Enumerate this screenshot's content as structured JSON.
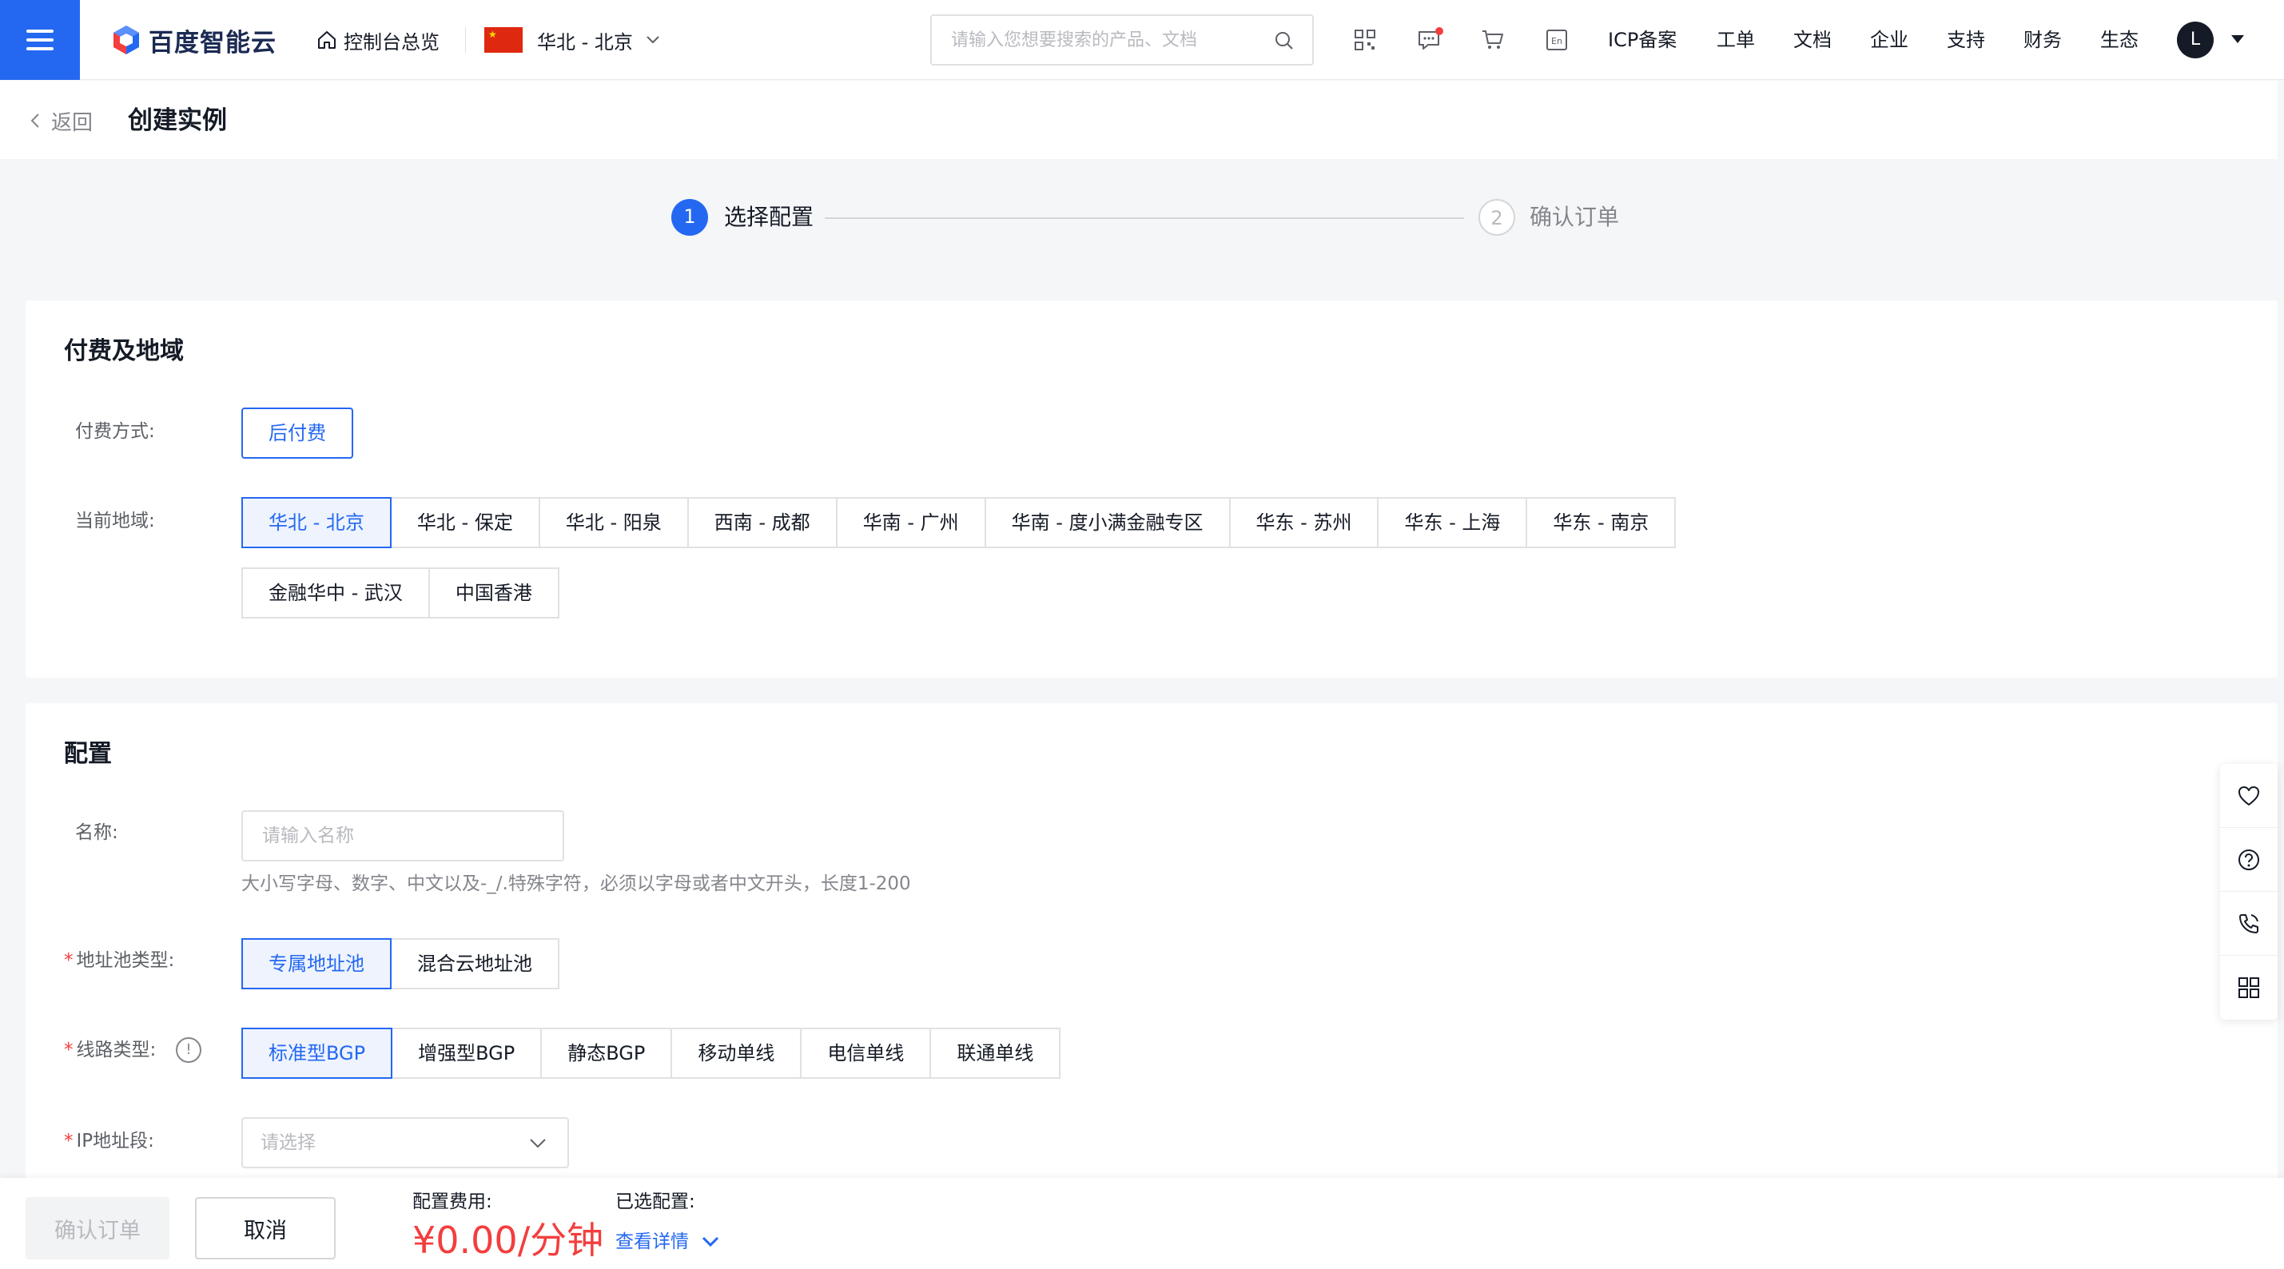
{
  "brand": {
    "logo_text": "百度智能云",
    "primary": "#2468f2",
    "danger": "#f33e3e"
  },
  "topnav": {
    "home_label": "控制台总览",
    "region_label": "华北 - 北京",
    "search_placeholder": "请输入您想要搜索的产品、文档",
    "icons": [
      "qrcode-icon",
      "message-icon",
      "cart-icon",
      "language-en-icon"
    ],
    "lang_icon_text": "En",
    "links": [
      "ICP备案",
      "工单",
      "文档",
      "企业",
      "支持",
      "财务",
      "生态"
    ],
    "avatar_letter": "L"
  },
  "subheader": {
    "back_label": "返回",
    "title": "创建实例"
  },
  "steps": [
    {
      "index": "1",
      "label": "选择配置",
      "active": true
    },
    {
      "index": "2",
      "label": "确认订单",
      "active": false
    }
  ],
  "billing": {
    "title": "付费及地域",
    "payment_label": "付费方式:",
    "payment_options": [
      "后付费"
    ],
    "region_label": "当前地域:",
    "regions_row1": [
      "华北 - 北京",
      "华北 - 保定",
      "华北 - 阳泉",
      "西南 - 成都",
      "华南 - 广州",
      "华南 - 度小满金融专区",
      "华东 - 苏州",
      "华东 - 上海",
      "华东 - 南京"
    ],
    "regions_row2": [
      "金融华中 - 武汉",
      "中国香港"
    ],
    "selected_region": "华北 - 北京"
  },
  "config": {
    "title": "配置",
    "name_label": "名称:",
    "name_placeholder": "请输入名称",
    "name_hint": "大小写字母、数字、中文以及-_/.特殊字符，必须以字母或者中文开头，长度1-200",
    "pool_label": "地址池类型:",
    "pool_options": [
      "专属地址池",
      "混合云地址池"
    ],
    "line_label": "线路类型:",
    "line_info": "!",
    "line_options": [
      "标准型BGP",
      "增强型BGP",
      "静态BGP",
      "移动单线",
      "电信单线",
      "联通单线"
    ],
    "ip_label": "IP地址段:",
    "ip_placeholder": "请选择",
    "required_mark": "*"
  },
  "float_bar": [
    "heart-icon",
    "help-icon",
    "phone-icon",
    "grid-icon"
  ],
  "bottombar": {
    "confirm_label": "确认订单",
    "cancel_label": "取消",
    "fee_label": "配置费用:",
    "fee_value": "¥0.00/分钟",
    "selected_label": "已选配置:",
    "detail_label": "查看详情"
  }
}
